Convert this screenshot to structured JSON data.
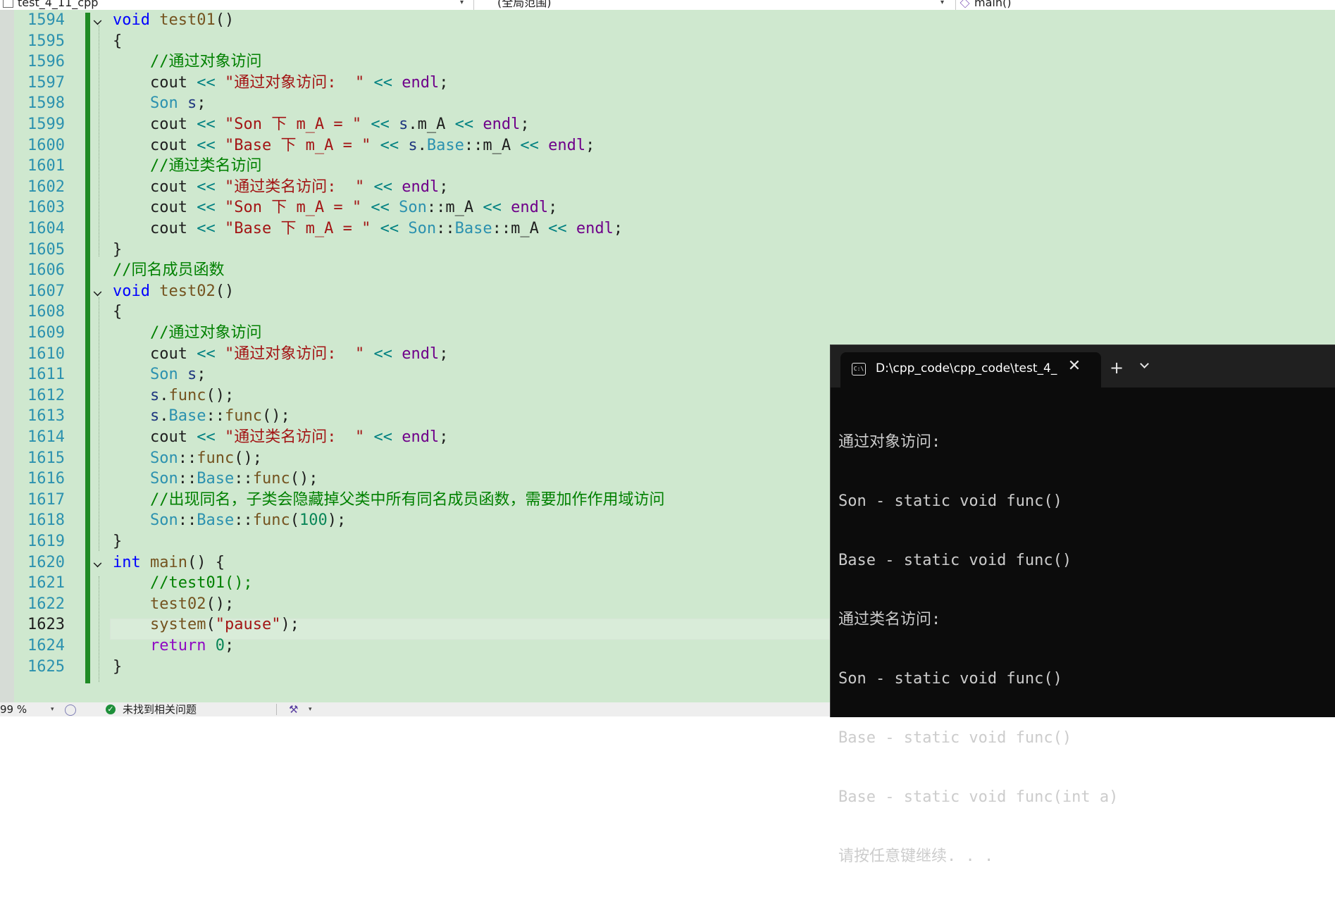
{
  "nav": {
    "file": "test_4_11_cpp",
    "scope": "(全局范围)",
    "member": "main()"
  },
  "editor": {
    "lines": [
      {
        "n": "1594",
        "fold": true,
        "tokens": [
          [
            "kw",
            "void"
          ],
          [
            "tx",
            " "
          ],
          [
            "fn",
            "test01"
          ],
          [
            "tx",
            "()"
          ]
        ]
      },
      {
        "n": "1595",
        "tokens": [
          [
            "tx",
            "{"
          ]
        ]
      },
      {
        "n": "1596",
        "tokens": [
          [
            "tx",
            "    "
          ],
          [
            "cm",
            "//通过对象访问"
          ]
        ]
      },
      {
        "n": "1597",
        "tokens": [
          [
            "tx",
            "    cout "
          ],
          [
            "op",
            "<<"
          ],
          [
            "tx",
            " "
          ],
          [
            "str",
            "\"通过对象访问:  \""
          ],
          [
            "tx",
            " "
          ],
          [
            "op",
            "<<"
          ],
          [
            "tx",
            " "
          ],
          [
            "endl",
            "endl"
          ],
          [
            "tx",
            ";"
          ]
        ]
      },
      {
        "n": "1598",
        "tokens": [
          [
            "tx",
            "    "
          ],
          [
            "ty",
            "Son"
          ],
          [
            "tx",
            " "
          ],
          [
            "var",
            "s"
          ],
          [
            "tx",
            ";"
          ]
        ]
      },
      {
        "n": "1599",
        "tokens": [
          [
            "tx",
            "    cout "
          ],
          [
            "op",
            "<<"
          ],
          [
            "tx",
            " "
          ],
          [
            "str",
            "\"Son 下 m_A = \""
          ],
          [
            "tx",
            " "
          ],
          [
            "op",
            "<<"
          ],
          [
            "tx",
            " "
          ],
          [
            "var",
            "s"
          ],
          [
            "tx",
            ".m_A "
          ],
          [
            "op",
            "<<"
          ],
          [
            "tx",
            " "
          ],
          [
            "endl",
            "endl"
          ],
          [
            "tx",
            ";"
          ]
        ]
      },
      {
        "n": "1600",
        "tokens": [
          [
            "tx",
            "    cout "
          ],
          [
            "op",
            "<<"
          ],
          [
            "tx",
            " "
          ],
          [
            "str",
            "\"Base 下 m_A = \""
          ],
          [
            "tx",
            " "
          ],
          [
            "op",
            "<<"
          ],
          [
            "tx",
            " "
          ],
          [
            "var",
            "s"
          ],
          [
            "tx",
            "."
          ],
          [
            "ty",
            "Base"
          ],
          [
            "tx",
            "::m_A "
          ],
          [
            "op",
            "<<"
          ],
          [
            "tx",
            " "
          ],
          [
            "endl",
            "endl"
          ],
          [
            "tx",
            ";"
          ]
        ]
      },
      {
        "n": "1601",
        "tokens": [
          [
            "tx",
            "    "
          ],
          [
            "cm",
            "//通过类名访问"
          ]
        ]
      },
      {
        "n": "1602",
        "tokens": [
          [
            "tx",
            "    cout "
          ],
          [
            "op",
            "<<"
          ],
          [
            "tx",
            " "
          ],
          [
            "str",
            "\"通过类名访问:  \""
          ],
          [
            "tx",
            " "
          ],
          [
            "op",
            "<<"
          ],
          [
            "tx",
            " "
          ],
          [
            "endl",
            "endl"
          ],
          [
            "tx",
            ";"
          ]
        ]
      },
      {
        "n": "1603",
        "tokens": [
          [
            "tx",
            "    cout "
          ],
          [
            "op",
            "<<"
          ],
          [
            "tx",
            " "
          ],
          [
            "str",
            "\"Son 下 m_A = \""
          ],
          [
            "tx",
            " "
          ],
          [
            "op",
            "<<"
          ],
          [
            "tx",
            " "
          ],
          [
            "ty",
            "Son"
          ],
          [
            "tx",
            "::m_A "
          ],
          [
            "op",
            "<<"
          ],
          [
            "tx",
            " "
          ],
          [
            "endl",
            "endl"
          ],
          [
            "tx",
            ";"
          ]
        ]
      },
      {
        "n": "1604",
        "tokens": [
          [
            "tx",
            "    cout "
          ],
          [
            "op",
            "<<"
          ],
          [
            "tx",
            " "
          ],
          [
            "str",
            "\"Base 下 m_A = \""
          ],
          [
            "tx",
            " "
          ],
          [
            "op",
            "<<"
          ],
          [
            "tx",
            " "
          ],
          [
            "ty",
            "Son"
          ],
          [
            "tx",
            "::"
          ],
          [
            "ty",
            "Base"
          ],
          [
            "tx",
            "::m_A "
          ],
          [
            "op",
            "<<"
          ],
          [
            "tx",
            " "
          ],
          [
            "endl",
            "endl"
          ],
          [
            "tx",
            ";"
          ]
        ]
      },
      {
        "n": "1605",
        "tokens": [
          [
            "tx",
            "}"
          ]
        ]
      },
      {
        "n": "1606",
        "tokens": [
          [
            "cm",
            "//同名成员函数"
          ]
        ]
      },
      {
        "n": "1607",
        "fold": true,
        "tokens": [
          [
            "kw",
            "void"
          ],
          [
            "tx",
            " "
          ],
          [
            "fn",
            "test02"
          ],
          [
            "tx",
            "()"
          ]
        ]
      },
      {
        "n": "1608",
        "tokens": [
          [
            "tx",
            "{"
          ]
        ]
      },
      {
        "n": "1609",
        "tokens": [
          [
            "tx",
            "    "
          ],
          [
            "cm",
            "//通过对象访问"
          ]
        ]
      },
      {
        "n": "1610",
        "tokens": [
          [
            "tx",
            "    cout "
          ],
          [
            "op",
            "<<"
          ],
          [
            "tx",
            " "
          ],
          [
            "str",
            "\"通过对象访问:  \""
          ],
          [
            "tx",
            " "
          ],
          [
            "op",
            "<<"
          ],
          [
            "tx",
            " "
          ],
          [
            "endl",
            "endl"
          ],
          [
            "tx",
            ";"
          ]
        ]
      },
      {
        "n": "1611",
        "tokens": [
          [
            "tx",
            "    "
          ],
          [
            "ty",
            "Son"
          ],
          [
            "tx",
            " "
          ],
          [
            "var",
            "s"
          ],
          [
            "tx",
            ";"
          ]
        ]
      },
      {
        "n": "1612",
        "tokens": [
          [
            "tx",
            "    "
          ],
          [
            "var",
            "s"
          ],
          [
            "tx",
            "."
          ],
          [
            "fn",
            "func"
          ],
          [
            "tx",
            "();"
          ]
        ]
      },
      {
        "n": "1613",
        "tokens": [
          [
            "tx",
            "    "
          ],
          [
            "var",
            "s"
          ],
          [
            "tx",
            "."
          ],
          [
            "ty",
            "Base"
          ],
          [
            "tx",
            "::"
          ],
          [
            "fn",
            "func"
          ],
          [
            "tx",
            "();"
          ]
        ]
      },
      {
        "n": "1614",
        "tokens": [
          [
            "tx",
            "    cout "
          ],
          [
            "op",
            "<<"
          ],
          [
            "tx",
            " "
          ],
          [
            "str",
            "\"通过类名访问:  \""
          ],
          [
            "tx",
            " "
          ],
          [
            "op",
            "<<"
          ],
          [
            "tx",
            " "
          ],
          [
            "endl",
            "endl"
          ],
          [
            "tx",
            ";"
          ]
        ]
      },
      {
        "n": "1615",
        "tokens": [
          [
            "tx",
            "    "
          ],
          [
            "ty",
            "Son"
          ],
          [
            "tx",
            "::"
          ],
          [
            "fn",
            "func"
          ],
          [
            "tx",
            "();"
          ]
        ]
      },
      {
        "n": "1616",
        "tokens": [
          [
            "tx",
            "    "
          ],
          [
            "ty",
            "Son"
          ],
          [
            "tx",
            "::"
          ],
          [
            "ty",
            "Base"
          ],
          [
            "tx",
            "::"
          ],
          [
            "fn",
            "func"
          ],
          [
            "tx",
            "();"
          ]
        ]
      },
      {
        "n": "1617",
        "tokens": [
          [
            "tx",
            "    "
          ],
          [
            "cm",
            "//出现同名，子类会隐藏掉父类中所有同名成员函数，需要加作作用域访问"
          ]
        ]
      },
      {
        "n": "1618",
        "tokens": [
          [
            "tx",
            "    "
          ],
          [
            "ty",
            "Son"
          ],
          [
            "tx",
            "::"
          ],
          [
            "ty",
            "Base"
          ],
          [
            "tx",
            "::"
          ],
          [
            "fn",
            "func"
          ],
          [
            "tx",
            "("
          ],
          [
            "num",
            "100"
          ],
          [
            "tx",
            ");"
          ]
        ]
      },
      {
        "n": "1619",
        "tokens": [
          [
            "tx",
            "}"
          ]
        ]
      },
      {
        "n": "1620",
        "fold": true,
        "tokens": [
          [
            "kw",
            "int"
          ],
          [
            "tx",
            " "
          ],
          [
            "fn",
            "main"
          ],
          [
            "tx",
            "() {"
          ]
        ]
      },
      {
        "n": "1621",
        "tokens": [
          [
            "tx",
            "    "
          ],
          [
            "cm",
            "//test01();"
          ]
        ]
      },
      {
        "n": "1622",
        "tokens": [
          [
            "tx",
            "    "
          ],
          [
            "fn",
            "test02"
          ],
          [
            "tx",
            "();"
          ]
        ]
      },
      {
        "n": "1623",
        "current": true,
        "tokens": [
          [
            "tx",
            "    "
          ],
          [
            "fn",
            "system"
          ],
          [
            "tx",
            "("
          ],
          [
            "str",
            "\"pause\""
          ],
          [
            "tx",
            ");"
          ]
        ]
      },
      {
        "n": "1624",
        "tokens": [
          [
            "tx",
            "    "
          ],
          [
            "ret",
            "return"
          ],
          [
            "tx",
            " "
          ],
          [
            "num",
            "0"
          ],
          [
            "tx",
            ";"
          ]
        ]
      },
      {
        "n": "1625",
        "tokens": [
          [
            "tx",
            "}"
          ]
        ]
      }
    ]
  },
  "status": {
    "zoom": "99 %",
    "issues": "未找到相关问题"
  },
  "console": {
    "tab_title": "D:\\cpp_code\\cpp_code\\test_4_",
    "close_glyph": "✕",
    "new_tab_glyph": "+",
    "output": [
      "通过对象访问:",
      "Son - static void func()",
      "Base - static void func()",
      "通过类名访问:",
      "Son - static void func()",
      "Base - static void func()",
      "Base - static void func(int a)"
    ],
    "prompt": "请按任意键继续. . . "
  }
}
